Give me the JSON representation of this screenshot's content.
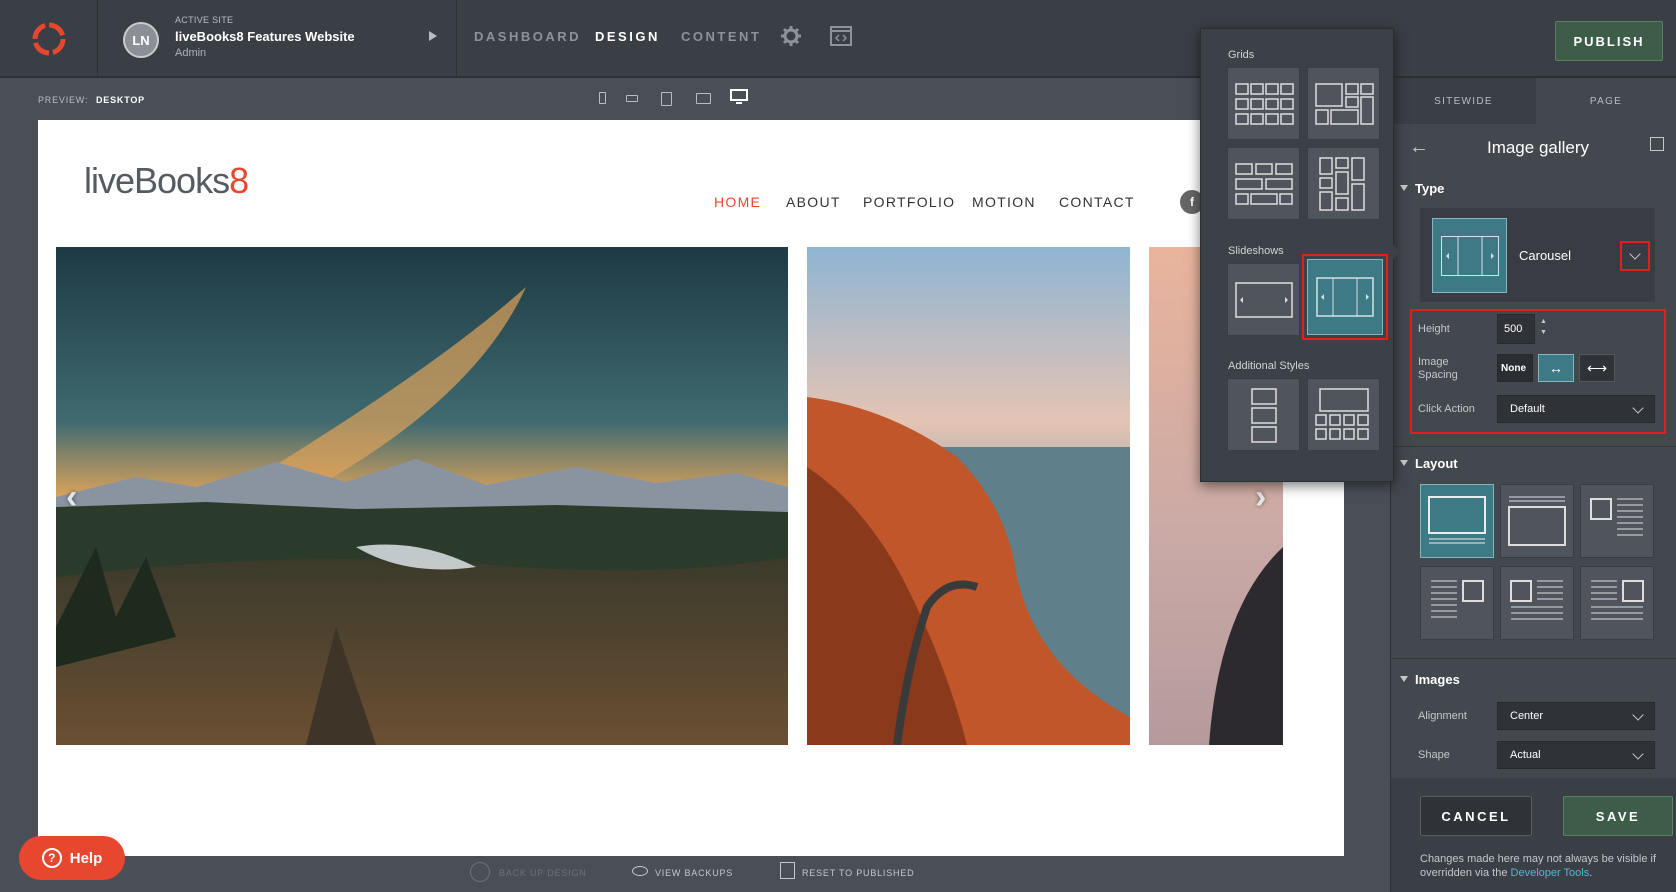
{
  "topbar": {
    "avatar_initials": "LN",
    "site_caption": "ACTIVE SITE",
    "site_name": "liveBooks8 Features Website",
    "site_role": "Admin",
    "nav": [
      "DASHBOARD",
      "DESIGN",
      "CONTENT"
    ],
    "active_nav": "DESIGN",
    "publish_label": "PUBLISH"
  },
  "preview": {
    "label": "PREVIEW:",
    "value": "DESKTOP"
  },
  "site_preview": {
    "logo_text": "liveBooks",
    "logo_number": "8",
    "menu": [
      "HOME",
      "ABOUT",
      "PORTFOLIO",
      "MOTION",
      "CONTACT"
    ],
    "active_menu": "HOME",
    "social_icon": "f"
  },
  "bottombar": {
    "backup": "BACK UP DESIGN",
    "view_backups": "VIEW BACKUPS",
    "reset": "RESET TO PUBLISHED"
  },
  "help_label": "Help",
  "flyout": {
    "grids": "Grids",
    "slideshows": "Slideshows",
    "additional": "Additional Styles"
  },
  "panel": {
    "tabs": [
      "SITEWIDE",
      "PAGE"
    ],
    "title": "Image gallery",
    "type_section": "Type",
    "type_value": "Carousel",
    "height_label": "Height",
    "height_value": "500",
    "spacing_label_1": "Image",
    "spacing_label_2": "Spacing",
    "spacing_none": "None",
    "click_label": "Click Action",
    "click_value": "Default",
    "layout_section": "Layout",
    "images_section": "Images",
    "alignment_label": "Alignment",
    "alignment_value": "Center",
    "shape_label": "Shape",
    "shape_value": "Actual",
    "cancel": "CANCEL",
    "save": "SAVE",
    "note": "Changes made here may not always be visible if overridden via the",
    "note_link": "Developer Tools",
    "note_end": "."
  },
  "colors": {
    "accent": "#e8472f",
    "teal": "#3d7a86",
    "publish_green": "#3d5d48",
    "highlight_red": "#e0201f"
  }
}
